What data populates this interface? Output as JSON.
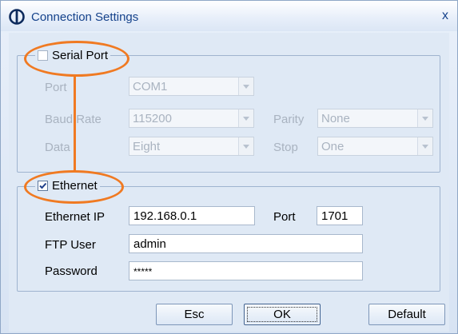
{
  "window": {
    "title": "Connection Settings",
    "close_glyph": "x",
    "app_icon": "cd-logo-icon"
  },
  "serial": {
    "checkbox_label": "Serial Port",
    "checked": false,
    "port_label": "Port",
    "port_value": "COM1",
    "baud_label": "Baud Rate",
    "baud_value": "115200",
    "parity_label": "Parity",
    "parity_value": "None",
    "data_label": "Data",
    "data_value": "Eight",
    "stop_label": "Stop",
    "stop_value": "One"
  },
  "ethernet": {
    "checkbox_label": "Ethernet",
    "checked": true,
    "ip_label": "Ethernet IP",
    "ip_value": "192.168.0.1",
    "port_label": "Port",
    "port_value": "1701",
    "ftp_user_label": "FTP User",
    "ftp_user_value": "admin",
    "password_label": "Password",
    "password_value": "*****"
  },
  "buttons": {
    "esc": "Esc",
    "ok": "OK",
    "default": "Default"
  },
  "colors": {
    "annotation": "#f07a22",
    "title_text": "#15428b",
    "disabled_text": "#a9b3c0"
  }
}
